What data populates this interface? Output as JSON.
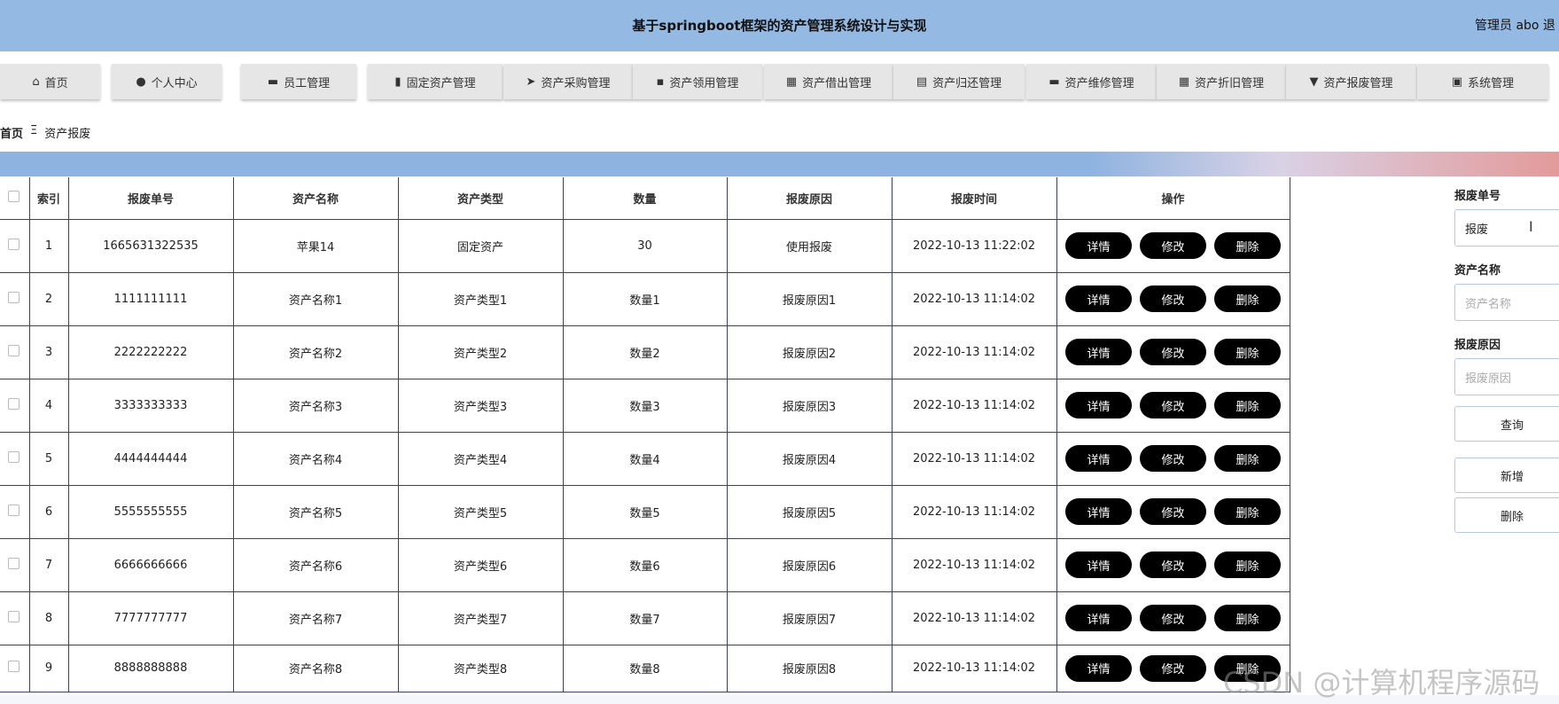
{
  "header": {
    "title": "基于springboot框架的资产管理系统设计与实现",
    "user": "管理员 abo 退"
  },
  "nav": [
    {
      "label": "首页",
      "icon": "home-icon",
      "glyph": "⌂"
    },
    {
      "label": "个人中心",
      "icon": "user-icon",
      "glyph": "●"
    },
    {
      "label": "员工管理",
      "icon": "briefcase-icon",
      "glyph": "▬"
    },
    {
      "label": "固定资产管理",
      "icon": "bar-chart-icon",
      "glyph": "▮"
    },
    {
      "label": "资产采购管理",
      "icon": "paper-plane-icon",
      "glyph": "➤"
    },
    {
      "label": "资产领用管理",
      "icon": "comment-icon",
      "glyph": "▪"
    },
    {
      "label": "资产借出管理",
      "icon": "grid-icon",
      "glyph": "▦"
    },
    {
      "label": "资产归还管理",
      "icon": "clipboard-icon",
      "glyph": "▤"
    },
    {
      "label": "资产维修管理",
      "icon": "monitor-icon",
      "glyph": "▬"
    },
    {
      "label": "资产折旧管理",
      "icon": "grid-icon",
      "glyph": "▦"
    },
    {
      "label": "资产报废管理",
      "icon": "trophy-icon",
      "glyph": "▼"
    },
    {
      "label": "系统管理",
      "icon": "clipboard-check-icon",
      "glyph": "▣"
    }
  ],
  "breadcrumb": {
    "home": "首页",
    "separator": "Ξ",
    "current": "资产报废"
  },
  "table": {
    "columns": [
      "索引",
      "报废单号",
      "资产名称",
      "资产类型",
      "数量",
      "报废原因",
      "报废时间",
      "操作"
    ],
    "actions": {
      "detail": "详情",
      "edit": "修改",
      "delete": "删除"
    },
    "rows": [
      {
        "index": "1",
        "no": "1665631322535",
        "name": "苹果14",
        "type": "固定资产",
        "qty": "30",
        "reason": "使用报废",
        "time": "2022-10-13 11:22:02"
      },
      {
        "index": "2",
        "no": "1111111111",
        "name": "资产名称1",
        "type": "资产类型1",
        "qty": "数量1",
        "reason": "报废原因1",
        "time": "2022-10-13 11:14:02"
      },
      {
        "index": "3",
        "no": "2222222222",
        "name": "资产名称2",
        "type": "资产类型2",
        "qty": "数量2",
        "reason": "报废原因2",
        "time": "2022-10-13 11:14:02"
      },
      {
        "index": "4",
        "no": "3333333333",
        "name": "资产名称3",
        "type": "资产类型3",
        "qty": "数量3",
        "reason": "报废原因3",
        "time": "2022-10-13 11:14:02"
      },
      {
        "index": "5",
        "no": "4444444444",
        "name": "资产名称4",
        "type": "资产类型4",
        "qty": "数量4",
        "reason": "报废原因4",
        "time": "2022-10-13 11:14:02"
      },
      {
        "index": "6",
        "no": "5555555555",
        "name": "资产名称5",
        "type": "资产类型5",
        "qty": "数量5",
        "reason": "报废原因5",
        "time": "2022-10-13 11:14:02"
      },
      {
        "index": "7",
        "no": "6666666666",
        "name": "资产名称6",
        "type": "资产类型6",
        "qty": "数量6",
        "reason": "报废原因6",
        "time": "2022-10-13 11:14:02"
      },
      {
        "index": "8",
        "no": "7777777777",
        "name": "资产名称7",
        "type": "资产类型7",
        "qty": "数量7",
        "reason": "报废原因7",
        "time": "2022-10-13 11:14:02"
      },
      {
        "index": "9",
        "no": "8888888888",
        "name": "资产名称8",
        "type": "资产类型8",
        "qty": "数量8",
        "reason": "报废原因8",
        "time": "2022-10-13 11:14:02"
      }
    ]
  },
  "search": {
    "scrap_no_label": "报废单号",
    "scrap_no_value": "报废",
    "asset_name_label": "资产名称",
    "asset_name_placeholder": "资产名称",
    "reason_label": "报废原因",
    "reason_placeholder": "报废原因",
    "query_button": "查询",
    "add_button": "新增",
    "delete_button": "删除"
  },
  "watermark": "CSDN @计算机程序源码"
}
